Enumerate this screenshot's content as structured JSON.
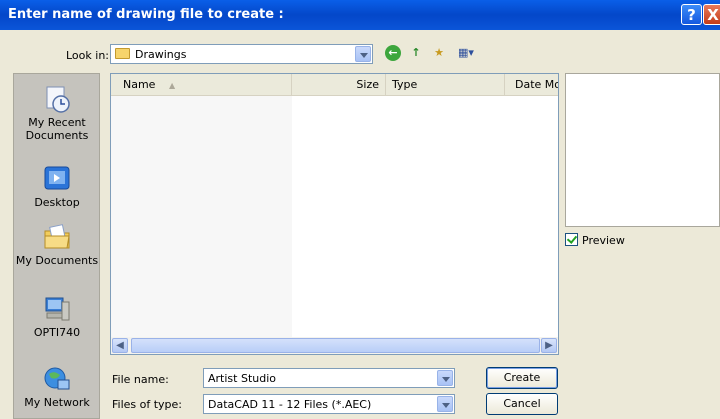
{
  "window": {
    "title": "Enter name of drawing file to create :",
    "help_label": "?",
    "close_label": "X"
  },
  "lookin": {
    "label": "Look in:",
    "value": "Drawings"
  },
  "toolbar": {
    "back_icon": "back-arrow-icon",
    "up_icon": "up-folder-icon",
    "new_folder_icon": "new-folder-icon",
    "views_icon": "views-menu-icon"
  },
  "places": [
    {
      "label": "My Recent\nDocuments",
      "icon": "recent-documents-icon"
    },
    {
      "label": "Desktop",
      "icon": "desktop-icon"
    },
    {
      "label": "My Documents",
      "icon": "my-documents-icon"
    },
    {
      "label": "OPTI740",
      "icon": "computer-icon"
    },
    {
      "label": "My Network",
      "icon": "network-icon"
    }
  ],
  "columns": [
    "Name",
    "Size",
    "Type",
    "Date Mo"
  ],
  "preview": {
    "label": "Preview",
    "checked": true
  },
  "filename": {
    "label": "File name:",
    "value": "Artist Studio"
  },
  "filetype": {
    "label": "Files of type:",
    "value": "DataCAD 11 - 12 Files (*.AEC)"
  },
  "buttons": {
    "create": "Create",
    "cancel": "Cancel"
  }
}
